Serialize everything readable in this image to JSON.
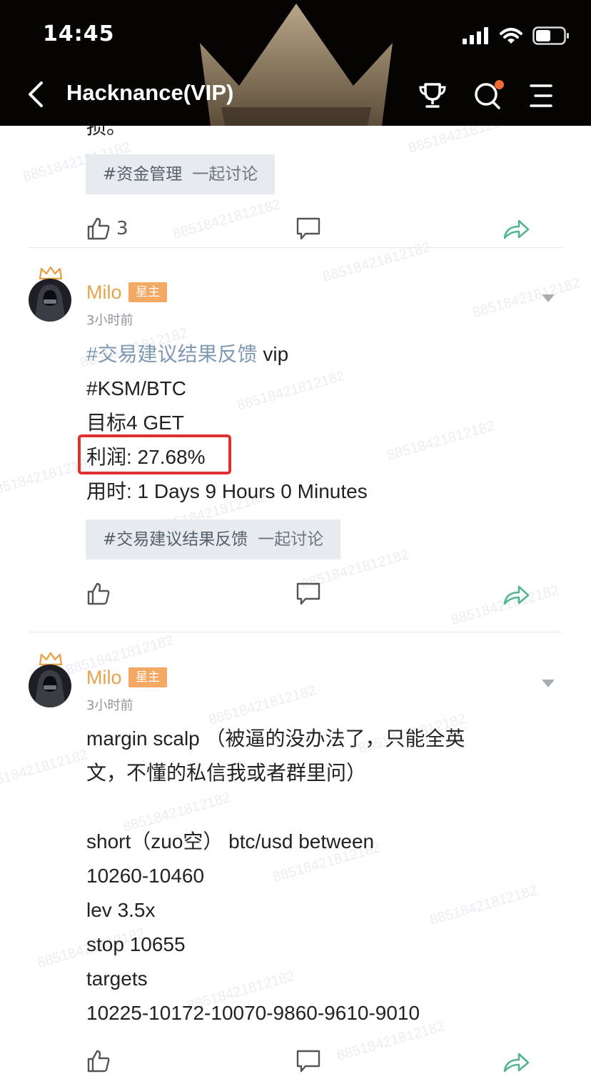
{
  "status_bar": {
    "time": "14:45"
  },
  "nav": {
    "title": "Hacknance(VIP)"
  },
  "watermark": "88518421812182",
  "post0": {
    "overflow_text": "损。",
    "tag": "#资金管理",
    "tag_join": "一起讨论",
    "like_count": "3"
  },
  "post1": {
    "author": "Milo",
    "badge": "星主",
    "time": "3小时前",
    "hashtag": "#交易建议结果反馈",
    "hashtag_suffix": " vip",
    "lines": [
      "#KSM/BTC",
      "目标4 GET",
      "利润: 27.68%",
      "用时: 1 Days 9 Hours 0 Minutes"
    ],
    "tag": "#交易建议结果反馈",
    "tag_join": "一起讨论"
  },
  "post2": {
    "author": "Milo",
    "badge": "星主",
    "time": "3小时前",
    "lines": [
      "margin scalp （被逼的没办法了，只能全英",
      "文，不懂的私信我或者群里问）",
      "",
      "short（zuo空） btc/usd between",
      "10260-10460",
      "lev 3.5x",
      "stop 10655",
      "targets",
      "10225-10172-10070-9860-9610-9010"
    ]
  }
}
